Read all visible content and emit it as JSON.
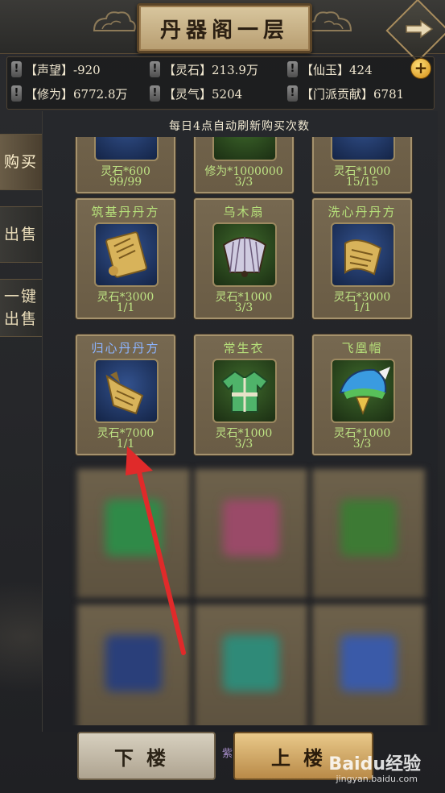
{
  "header": {
    "title": "丹器阁一层"
  },
  "stats": [
    {
      "label": "【声望】-920"
    },
    {
      "label": "【灵石】213.9万"
    },
    {
      "label": "【仙玉】424"
    },
    {
      "label": "【修为】6772.8万"
    },
    {
      "label": "【灵气】5204"
    },
    {
      "label": "【门派贡献】6781"
    }
  ],
  "plus_label": "+",
  "excl_mark": "!",
  "tabs": [
    {
      "label": "购买"
    },
    {
      "label": "出售"
    },
    {
      "label": "一键出售"
    }
  ],
  "refresh_notice": "每日4点自动刷新购买次数",
  "partial_row": [
    {
      "price": "灵石*600",
      "qty": "99/99"
    },
    {
      "price": "修为*1000000",
      "qty": "3/3"
    },
    {
      "price": "灵石*1000",
      "qty": "15/15"
    }
  ],
  "items": [
    {
      "name": "筑基丹丹方",
      "price": "灵石*3000",
      "qty": "1/1",
      "icon": "scroll-icon",
      "frame": "blue",
      "name_color": "green"
    },
    {
      "name": "乌木扇",
      "price": "灵石*1000",
      "qty": "3/3",
      "icon": "fan-icon",
      "frame": "green",
      "name_color": "green"
    },
    {
      "name": "洗心丹丹方",
      "price": "灵石*3000",
      "qty": "1/1",
      "icon": "scroll-icon",
      "frame": "blue",
      "name_color": "green"
    },
    {
      "name": "归心丹丹方",
      "price": "灵石*7000",
      "qty": "1/1",
      "icon": "scroll-icon",
      "frame": "blue",
      "name_color": "blue"
    },
    {
      "name": "常生衣",
      "price": "灵石*1000",
      "qty": "3/3",
      "icon": "robe-icon",
      "frame": "green",
      "name_color": "green"
    },
    {
      "name": "飞凰帽",
      "price": "灵石*1000",
      "qty": "3/3",
      "icon": "phoenix-hat-icon",
      "frame": "green",
      "name_color": "green"
    }
  ],
  "buttons": {
    "down": "下楼",
    "up": "上楼"
  },
  "misc": {
    "purple_char": "紫"
  },
  "watermark": {
    "text": "Baidu经验",
    "sub": "jingyan.baidu.com"
  },
  "colors": {
    "accent_gold": "#d9b46a",
    "item_green": "#bde283",
    "item_blue": "#8cb4ff",
    "arrow_red": "#e02a2a"
  }
}
